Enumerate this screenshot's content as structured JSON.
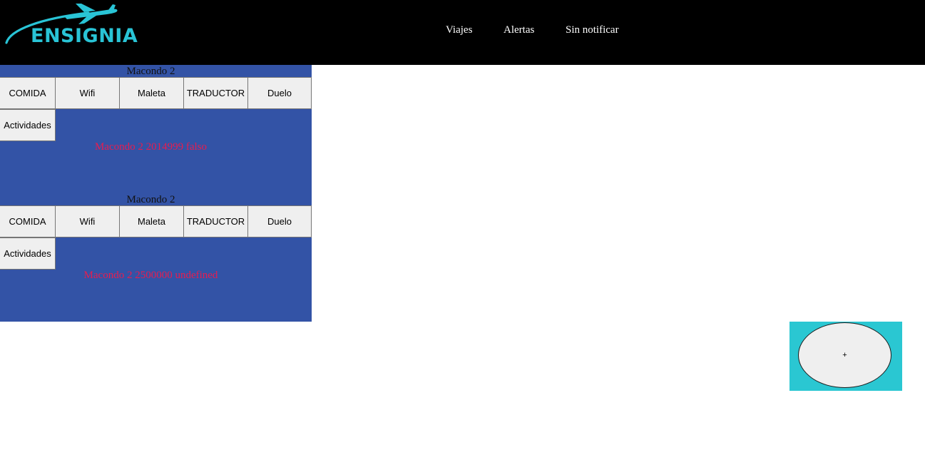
{
  "header": {
    "logo_text": "ENSIGNIA",
    "nav": [
      {
        "label": "Viajes"
      },
      {
        "label": "Alertas"
      },
      {
        "label": "Sin notificar"
      }
    ]
  },
  "trips": [
    {
      "title": "Macondo 2",
      "buttons": [
        "COMIDA",
        "Wifi",
        "Maleta",
        "TRADUCTOR",
        "Duelo",
        "Actividades"
      ],
      "info": "Macondo 2 2014999 falso"
    },
    {
      "title": "Macondo 2",
      "buttons": [
        "COMIDA",
        "Wifi",
        "Maleta",
        "TRADUCTOR",
        "Duelo",
        "Actividades"
      ],
      "info": "Macondo 2 2500000 undefined"
    }
  ],
  "fab": {
    "label": "+"
  },
  "colors": {
    "header_bg": "#000000",
    "brand": "#29c4d6",
    "card_bg": "#3353a6",
    "info_text": "#e81c4f",
    "fab_bg": "#2ac7d2"
  },
  "icons": {
    "logo": "airplane-swoosh-icon"
  }
}
